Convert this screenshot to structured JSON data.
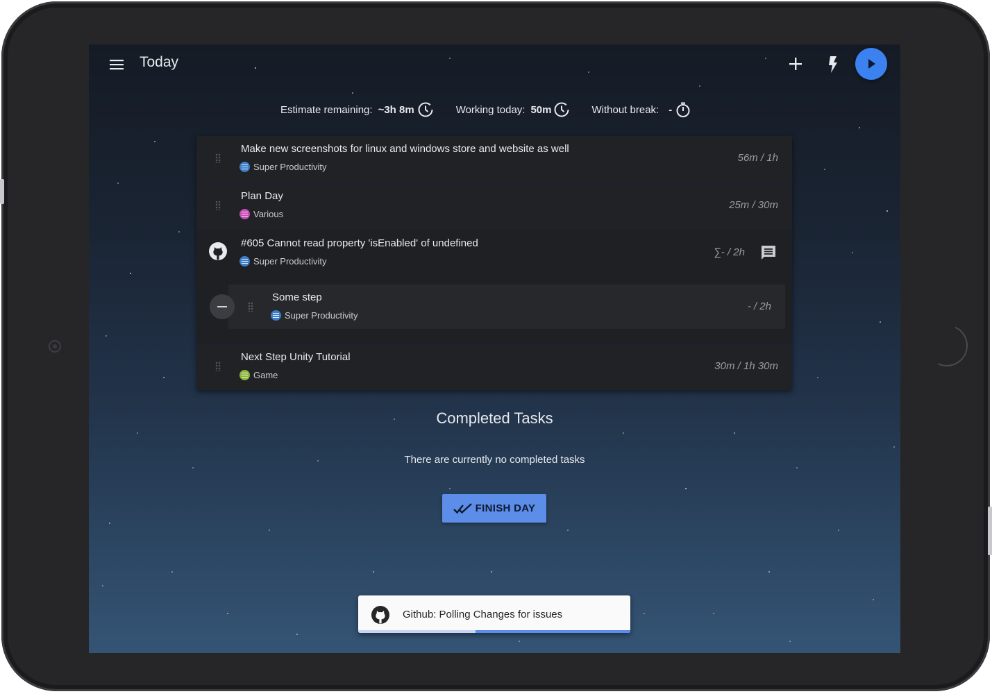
{
  "header": {
    "title": "Today",
    "menu_icon": "menu-icon",
    "add_icon": "add-icon",
    "bolt_icon": "bolt-icon",
    "play_icon": "play-icon"
  },
  "stats": {
    "estimate_label": "Estimate remaining:",
    "estimate_value": "~3h 8m",
    "working_label": "Working today:",
    "working_value": "50m",
    "break_label": "Without break:",
    "break_value": "-"
  },
  "tasks": [
    {
      "title": "Make new screenshots for linux and windows store and website as well",
      "project": "Super Productivity",
      "project_color": "#3d7ec9",
      "time": "56m / 1h"
    },
    {
      "title": "Plan Day",
      "project": "Various",
      "project_color": "#c34db5",
      "time": "25m / 30m"
    },
    {
      "title": "#605 Cannot read property 'isEnabled' of undefined",
      "project": "Super Productivity",
      "project_color": "#3d7ec9",
      "time": "∑- / 2h",
      "subtask": {
        "title": "Some step",
        "project": "Super Productivity",
        "project_color": "#3d7ec9",
        "time": "- / 2h"
      }
    },
    {
      "title": "Next Step Unity Tutorial",
      "project": "Game",
      "project_color": "#8bb63a",
      "time": "30m / 1h 30m"
    }
  ],
  "completed": {
    "title": "Completed Tasks",
    "empty_text": "There are currently no completed tasks",
    "finish_label": "FINISH DAY"
  },
  "snackbar": {
    "text": "Github: Polling Changes for issues",
    "progress": 0.57
  },
  "colors": {
    "accent": "#5b8de9",
    "play": "#3b82f0"
  }
}
